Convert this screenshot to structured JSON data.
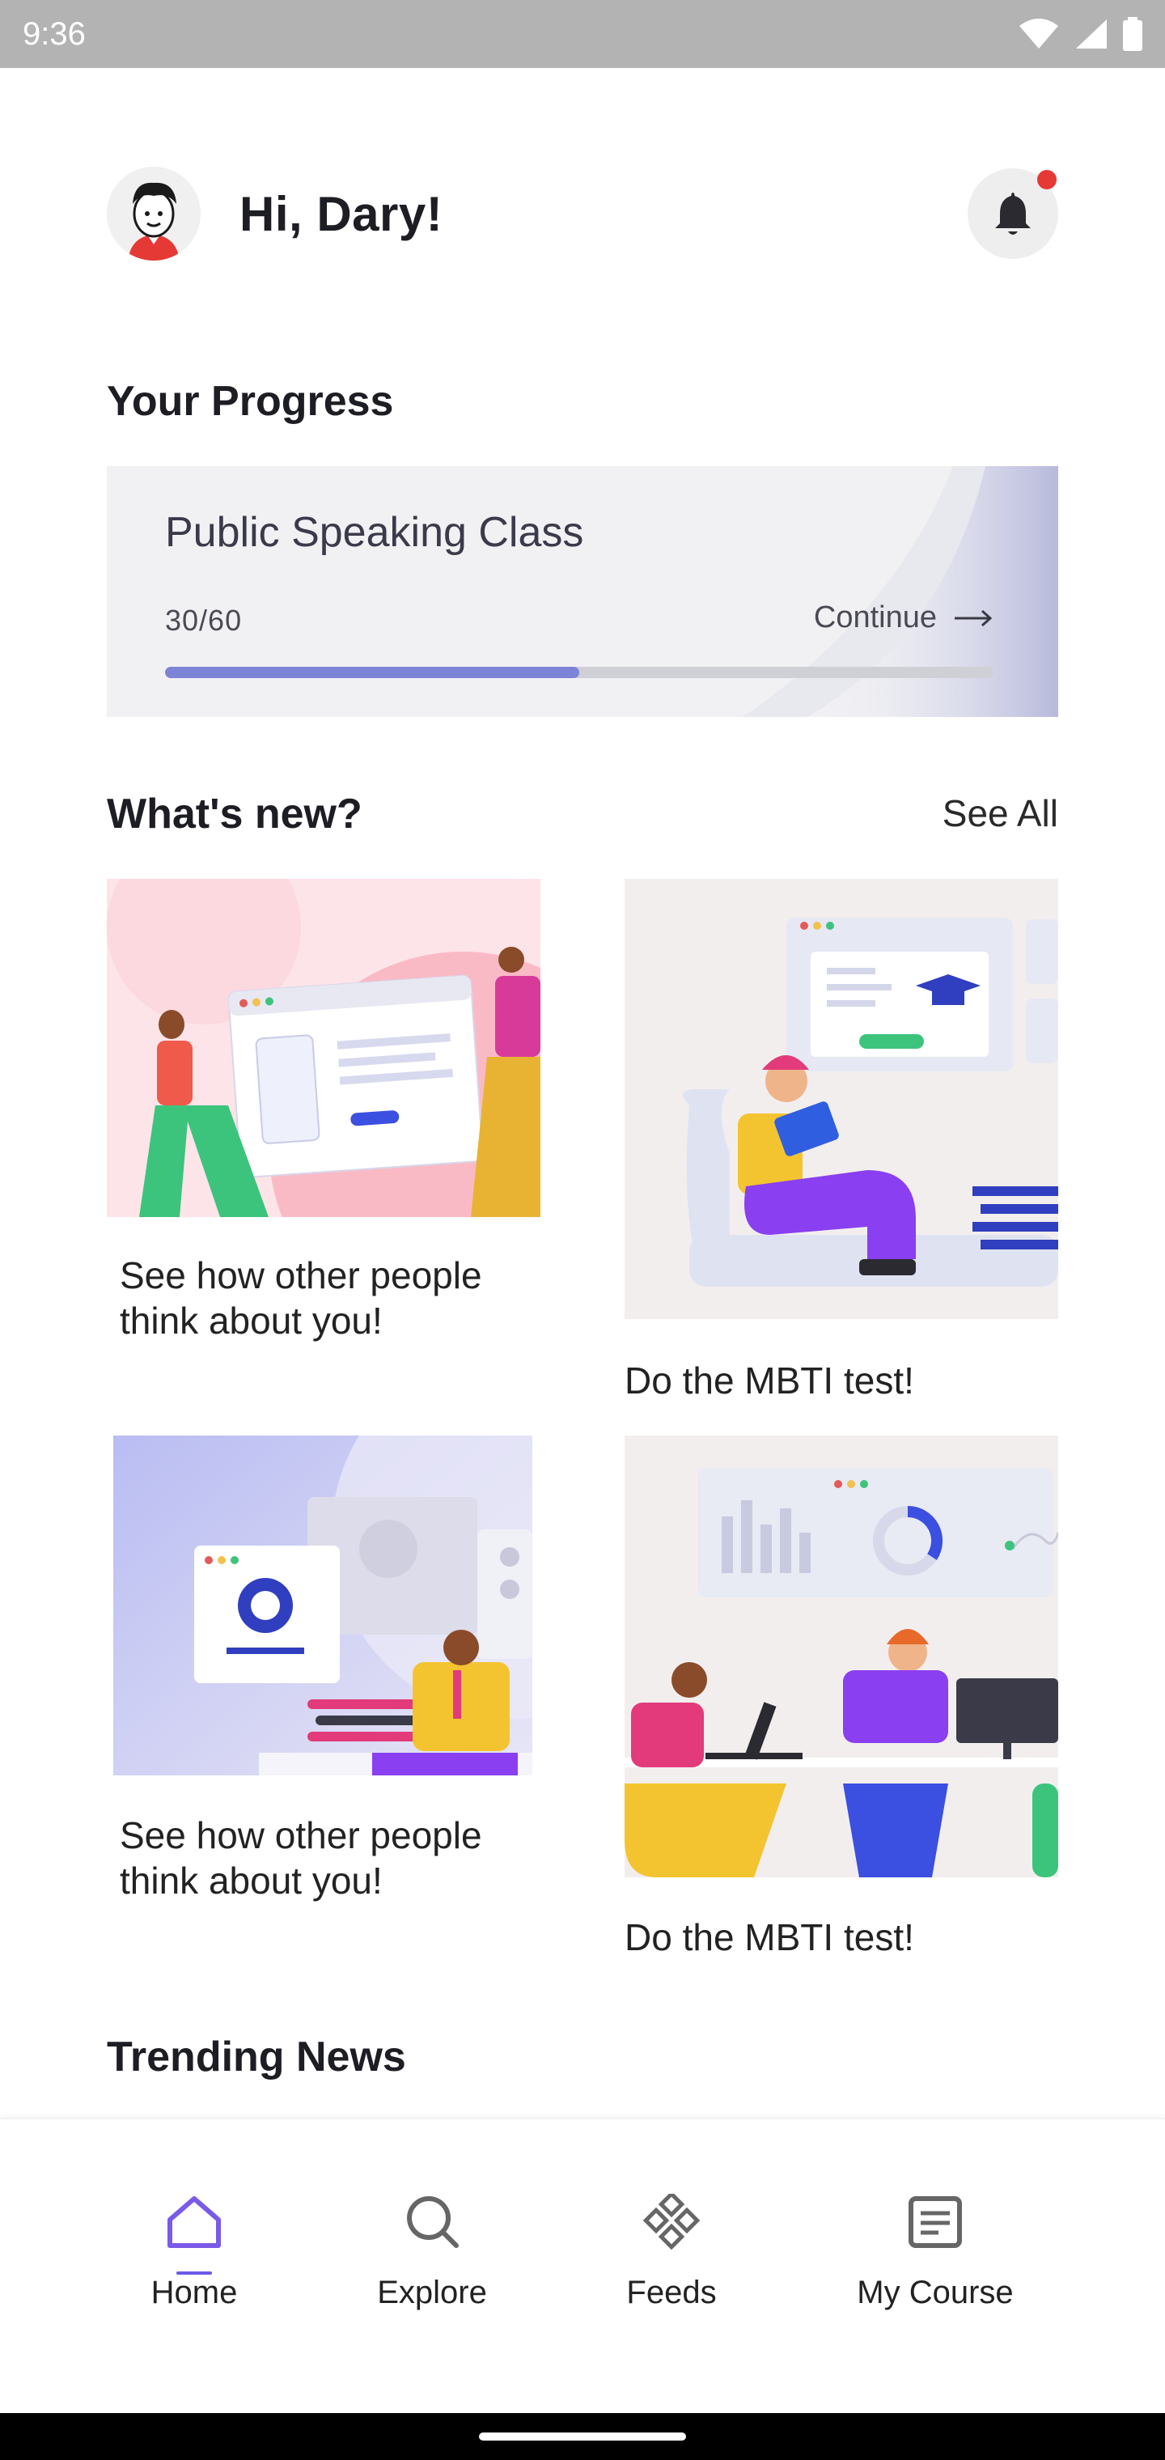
{
  "status_bar": {
    "time": "9:36"
  },
  "header": {
    "greeting": "Hi, Dary!"
  },
  "progress": {
    "section_title": "Your Progress",
    "course_name": "Public Speaking Class",
    "count_text": "30/60",
    "completed": 30,
    "total": 60,
    "continue_label": "Continue"
  },
  "whats_new": {
    "section_title": "What's new?",
    "see_all_label": "See All",
    "cards": [
      {
        "caption": "See how other people think about you!"
      },
      {
        "caption": "Do the MBTI test!"
      },
      {
        "caption": "See how other people think about you!"
      },
      {
        "caption": "Do the MBTI test!"
      }
    ]
  },
  "trending": {
    "section_title": "Trending News"
  },
  "bottom_nav": {
    "items": [
      {
        "label": "Home",
        "icon": "home-icon",
        "active": true
      },
      {
        "label": "Explore",
        "icon": "search-icon",
        "active": false
      },
      {
        "label": "Feeds",
        "icon": "feeds-icon",
        "active": false
      },
      {
        "label": "My Course",
        "icon": "course-icon",
        "active": false
      }
    ]
  },
  "colors": {
    "accent": "#7d83d6",
    "nav_active": "#6b5be5",
    "notification_dot": "#e53935"
  }
}
